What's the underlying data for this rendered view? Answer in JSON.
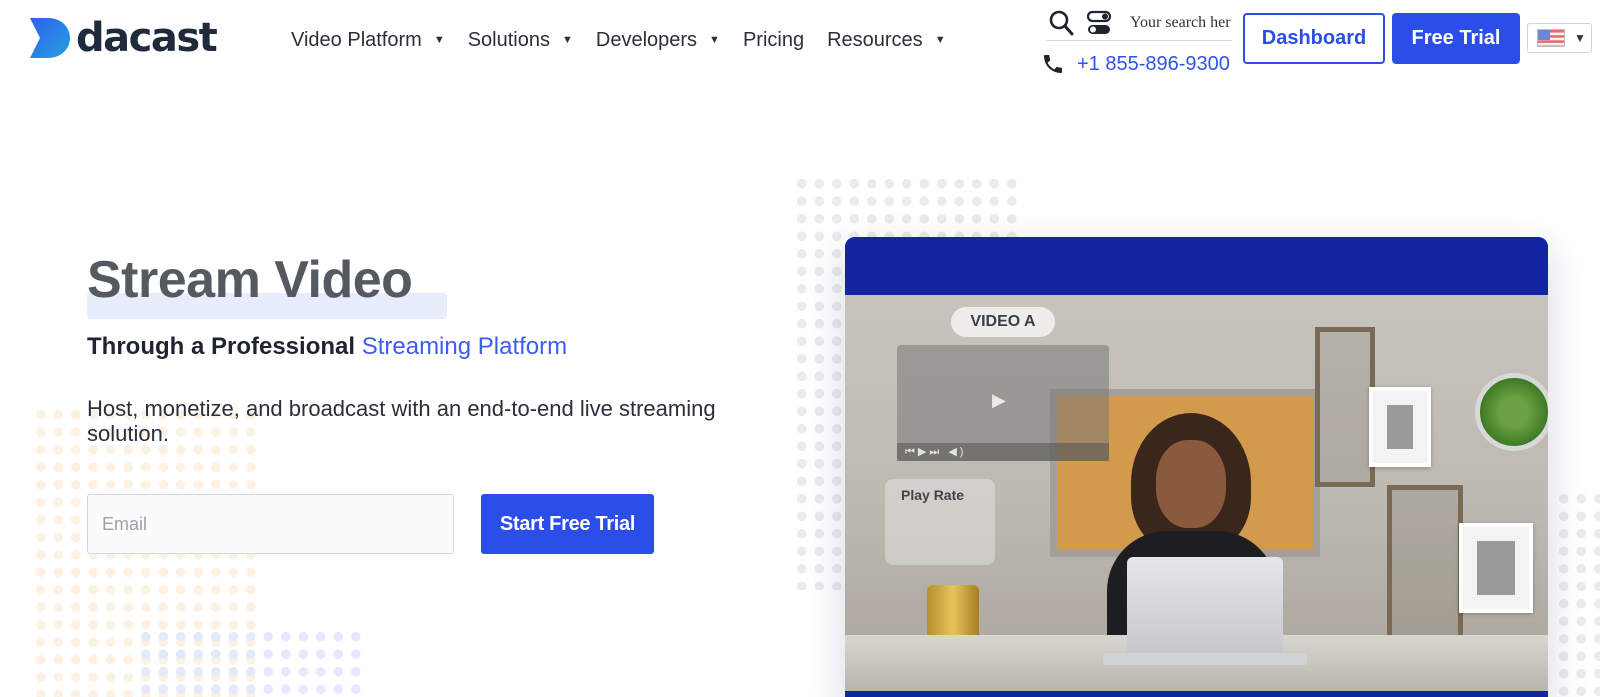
{
  "brand": {
    "name": "dacast",
    "colors": {
      "primary": "#2b4de8",
      "accent_text": "#3d5cf0",
      "video_card": "#1226a3",
      "logo_gradient": [
        "#2f5fe8",
        "#23a2e3"
      ]
    }
  },
  "nav": {
    "items": [
      {
        "label": "Video Platform",
        "has_dropdown": true
      },
      {
        "label": "Solutions",
        "has_dropdown": true
      },
      {
        "label": "Developers",
        "has_dropdown": true
      },
      {
        "label": "Pricing",
        "has_dropdown": false
      },
      {
        "label": "Resources",
        "has_dropdown": true
      }
    ]
  },
  "utility": {
    "search_placeholder": "Your search her",
    "icons": [
      "search-icon",
      "toggle-icon",
      "phone-icon"
    ],
    "phone": "+1 855-896-9300"
  },
  "header_buttons": {
    "dashboard": "Dashboard",
    "free_trial": "Free Trial",
    "language_flag": "us-flag-icon"
  },
  "hero": {
    "title": "Stream Video",
    "subtitle_prefix": "Through a Professional ",
    "subtitle_accent": "Streaming Platform",
    "description": "Host, monetize, and broadcast with an end-to-end live streaming solution.",
    "email_placeholder": "Email",
    "cta": "Start Free Trial"
  },
  "video": {
    "badge": "VIDEO A",
    "overlay_label": "Play Rate"
  }
}
